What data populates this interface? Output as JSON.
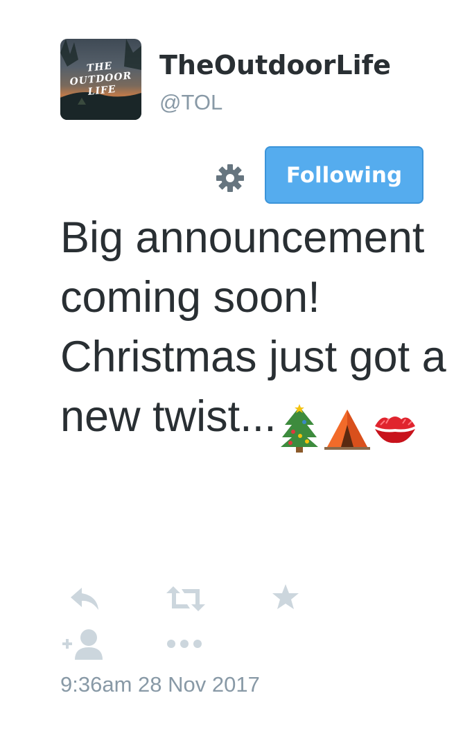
{
  "header": {
    "display_name": "TheOutdoorLife",
    "handle": "@TOL",
    "avatar_text": [
      "THE",
      "OUTDOOR",
      "LIFE"
    ]
  },
  "actions_bar": {
    "follow_label": "Following",
    "settings_icon": "gear-icon"
  },
  "tweet": {
    "text": "Big announcement coming soon! Christmas just got a new twist...",
    "emojis": [
      "christmas-tree-emoji",
      "tent-emoji",
      "kiss-mark-emoji"
    ],
    "timestamp": "9:36am 28 Nov 2017"
  },
  "tweet_actions": [
    "reply-icon",
    "retweet-icon",
    "favorite-icon",
    "follow-user-icon",
    "more-icon"
  ],
  "colors": {
    "accent": "#55acee",
    "muted": "#8899a6",
    "icon": "#ccd6dd",
    "text": "#292f33"
  }
}
